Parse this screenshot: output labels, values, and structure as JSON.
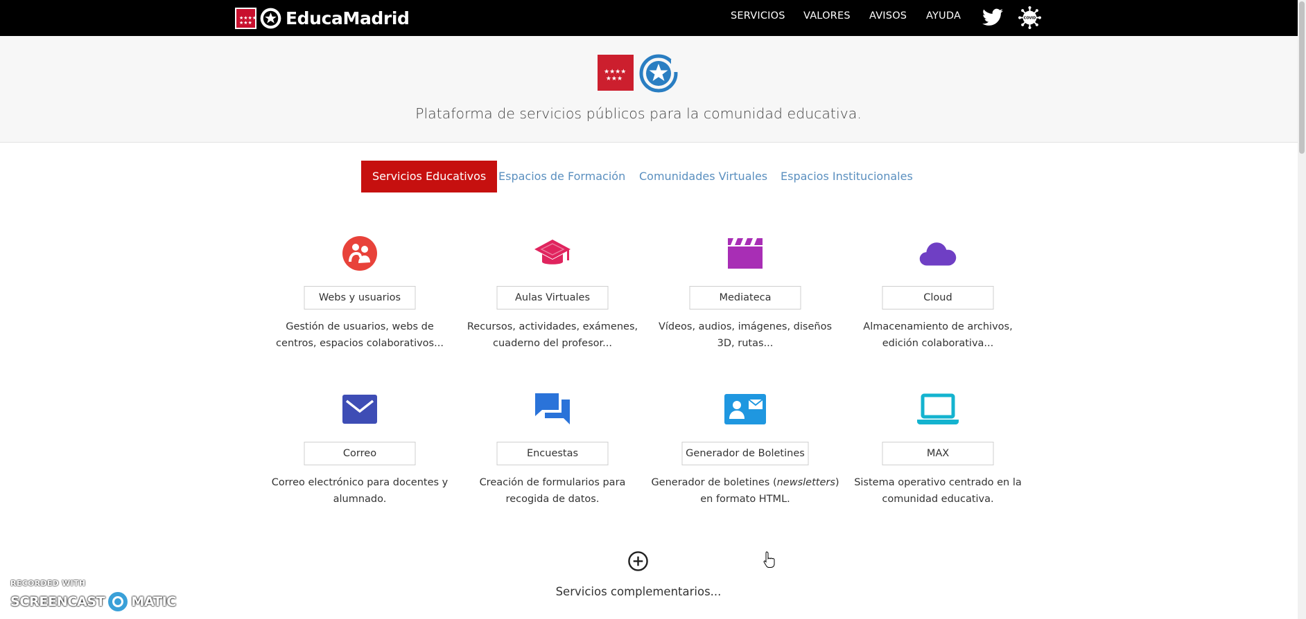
{
  "brand": {
    "name": "EducaMadrid"
  },
  "nav": {
    "items": [
      {
        "label": "SERVICIOS"
      },
      {
        "label": "VALORES"
      },
      {
        "label": "AVISOS"
      },
      {
        "label": "AYUDA"
      }
    ],
    "twitter_icon": "twitter-icon",
    "covid_icon": "covid-icon"
  },
  "hero": {
    "tagline": "Plataforma de servicios públicos para la comunidad educativa."
  },
  "tabs": [
    {
      "label": "Servicios Educativos",
      "active": true
    },
    {
      "label": "Espacios de Formación",
      "active": false
    },
    {
      "label": "Comunidades Virtuales",
      "active": false
    },
    {
      "label": "Espacios Institucionales",
      "active": false
    }
  ],
  "services": [
    {
      "label": "Webs y usuarios",
      "desc1": "Gestión de usuarios, webs de",
      "desc2": "centros, espacios colaborativos...",
      "icon": "users-web-icon",
      "color": "#e8423a"
    },
    {
      "label": "Aulas Virtuales",
      "desc1": "Recursos, actividades, exámenes,",
      "desc2": "cuaderno del profesor...",
      "icon": "graduation-cap-icon",
      "color": "#e0245e"
    },
    {
      "label": "Mediateca",
      "desc1": "Vídeos, audios, imágenes, diseños",
      "desc2": "3D, rutas...",
      "icon": "clapperboard-icon",
      "color": "#a82eb5"
    },
    {
      "label": "Cloud",
      "desc1": "Almacenamiento de archivos,",
      "desc2": "edición colaborativa...",
      "icon": "cloud-icon",
      "color": "#6f3fc4"
    },
    {
      "label": "Correo",
      "desc1": "Correo electrónico para docentes y",
      "desc2": "alumnado.",
      "icon": "mail-icon",
      "color": "#3e4db5"
    },
    {
      "label": "Encuestas",
      "desc1": "Creación de formularios para",
      "desc2": "recogida de datos.",
      "icon": "chat-bubbles-icon",
      "color": "#2a73d9"
    },
    {
      "label": "Generador de Boletines",
      "desc1_pre": "Generador de boletines (",
      "desc1_em": "newsletters",
      "desc1_post": ")",
      "desc2": "en formato HTML.",
      "icon": "contact-card-icon",
      "color": "#1f97e0"
    },
    {
      "label": "MAX",
      "desc1": "Sistema operativo centrado en la",
      "desc2": "comunidad educativa.",
      "icon": "laptop-icon",
      "color": "#14b3cf"
    }
  ],
  "more": {
    "label": "Servicios complementarios...",
    "icon": "plus-circle-icon"
  },
  "watermark": {
    "line1": "RECORDED WITH",
    "line2_a": "SCREENCAST",
    "line2_b": "MATIC"
  },
  "colors": {
    "accent": "#c6100f",
    "link": "#5a8fbf",
    "topbar": "#000000"
  }
}
